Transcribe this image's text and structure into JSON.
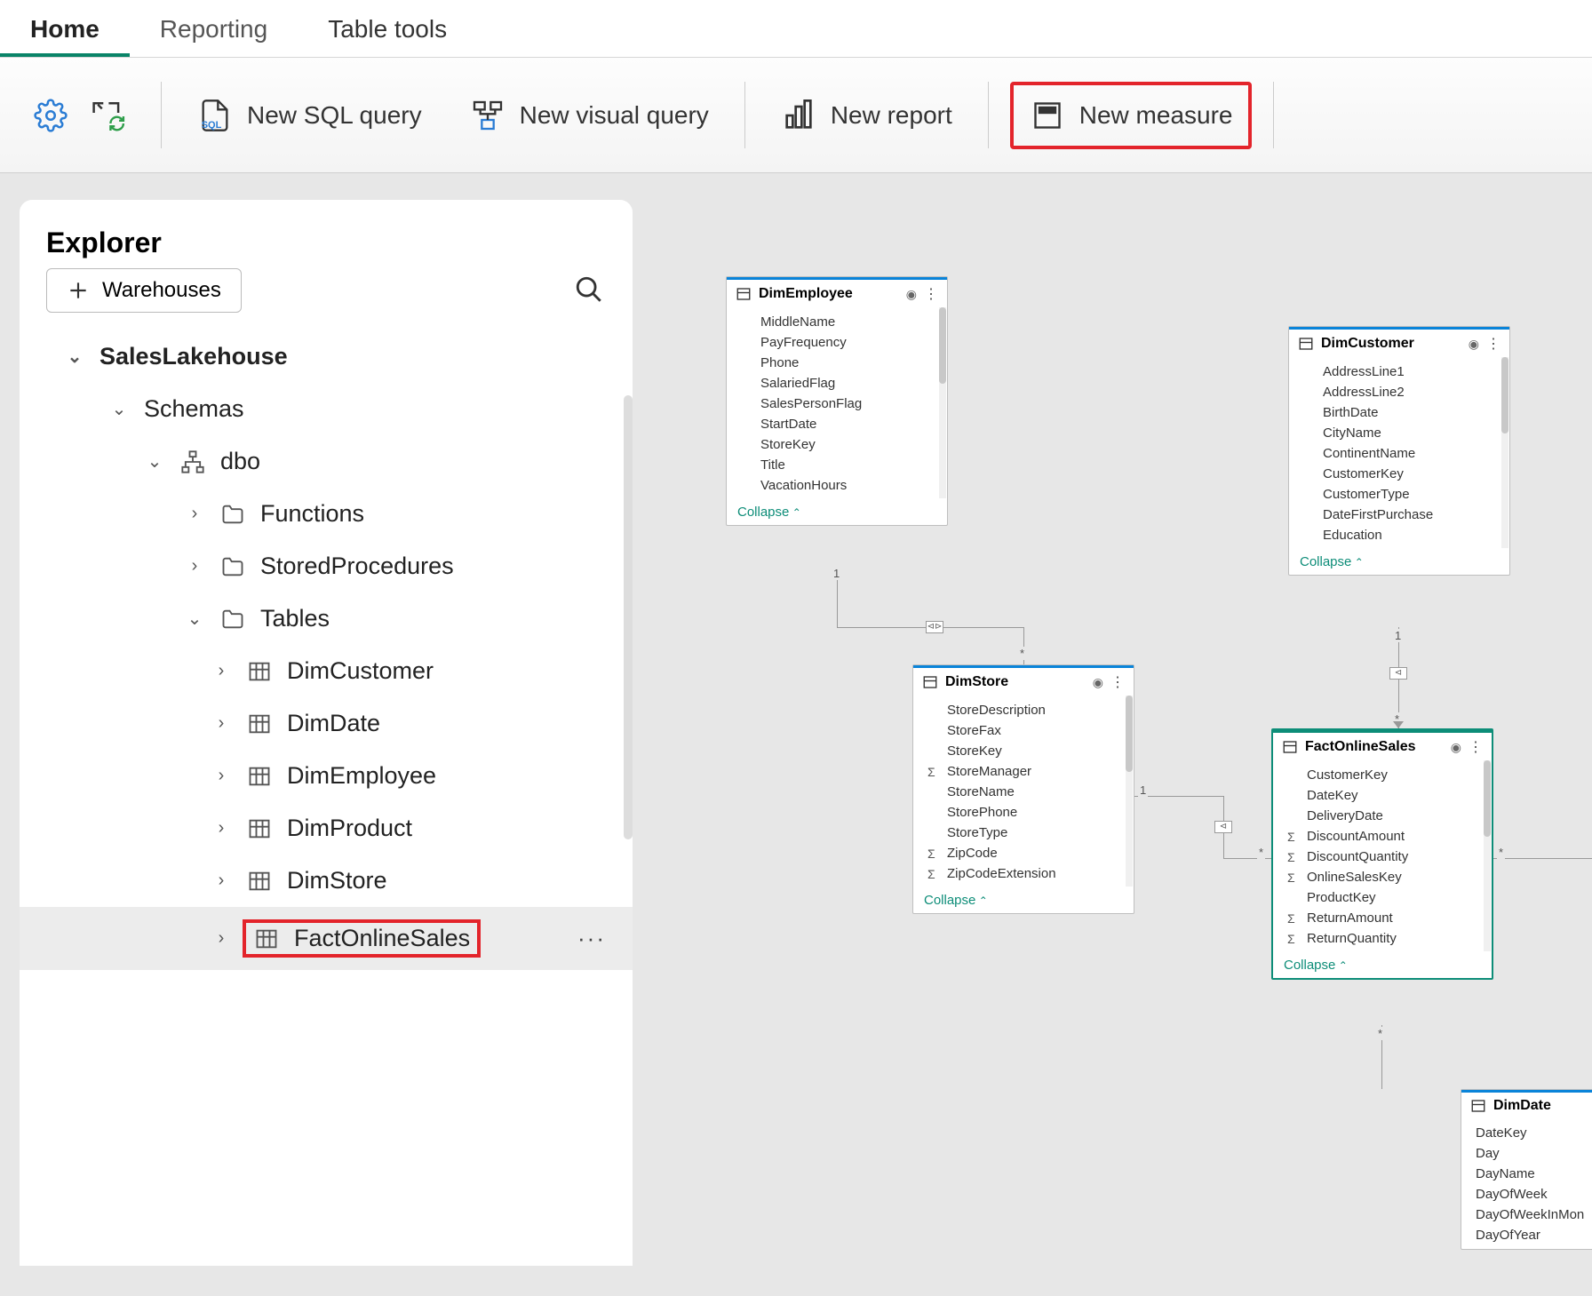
{
  "tabs": {
    "home": "Home",
    "reporting": "Reporting",
    "tools": "Table tools"
  },
  "ribbon": {
    "new_sql": "New SQL query",
    "new_visual": "New visual query",
    "new_report": "New report",
    "new_measure": "New measure"
  },
  "explorer": {
    "title": "Explorer",
    "warehouses_btn": "Warehouses",
    "root": "SalesLakehouse",
    "schemas": "Schemas",
    "dbo": "dbo",
    "folders": {
      "functions": "Functions",
      "sprocs": "StoredProcedures",
      "tables": "Tables"
    },
    "tables": [
      "DimCustomer",
      "DimDate",
      "DimEmployee",
      "DimProduct",
      "DimStore",
      "FactOnlineSales"
    ]
  },
  "entities": {
    "DimEmployee": {
      "title": "DimEmployee",
      "collapse": "Collapse",
      "cols": [
        {
          "n": "MiddleName"
        },
        {
          "n": "PayFrequency"
        },
        {
          "n": "Phone"
        },
        {
          "n": "SalariedFlag"
        },
        {
          "n": "SalesPersonFlag"
        },
        {
          "n": "StartDate"
        },
        {
          "n": "StoreKey"
        },
        {
          "n": "Title"
        },
        {
          "n": "VacationHours"
        }
      ]
    },
    "DimCustomer": {
      "title": "DimCustomer",
      "collapse": "Collapse",
      "cols": [
        {
          "n": "AddressLine1"
        },
        {
          "n": "AddressLine2"
        },
        {
          "n": "BirthDate"
        },
        {
          "n": "CityName"
        },
        {
          "n": "ContinentName"
        },
        {
          "n": "CustomerKey"
        },
        {
          "n": "CustomerType"
        },
        {
          "n": "DateFirstPurchase"
        },
        {
          "n": "Education"
        }
      ]
    },
    "DimStore": {
      "title": "DimStore",
      "collapse": "Collapse",
      "cols": [
        {
          "n": "StoreDescription"
        },
        {
          "n": "StoreFax"
        },
        {
          "n": "StoreKey"
        },
        {
          "n": "StoreManager",
          "s": "Σ"
        },
        {
          "n": "StoreName"
        },
        {
          "n": "StorePhone"
        },
        {
          "n": "StoreType"
        },
        {
          "n": "ZipCode",
          "s": "Σ"
        },
        {
          "n": "ZipCodeExtension",
          "s": "Σ"
        }
      ]
    },
    "FactOnlineSales": {
      "title": "FactOnlineSales",
      "collapse": "Collapse",
      "cols": [
        {
          "n": "CustomerKey"
        },
        {
          "n": "DateKey"
        },
        {
          "n": "DeliveryDate"
        },
        {
          "n": "DiscountAmount",
          "s": "Σ"
        },
        {
          "n": "DiscountQuantity",
          "s": "Σ"
        },
        {
          "n": "OnlineSalesKey",
          "s": "Σ"
        },
        {
          "n": "ProductKey"
        },
        {
          "n": "ReturnAmount",
          "s": "Σ"
        },
        {
          "n": "ReturnQuantity",
          "s": "Σ"
        }
      ]
    },
    "DimDate": {
      "title": "DimDate",
      "cols": [
        {
          "n": "DateKey"
        },
        {
          "n": "Day"
        },
        {
          "n": "DayName"
        },
        {
          "n": "DayOfWeek"
        },
        {
          "n": "DayOfWeekInMon"
        },
        {
          "n": "DayOfYear"
        }
      ]
    }
  },
  "rel": {
    "one": "1",
    "many": "*"
  }
}
